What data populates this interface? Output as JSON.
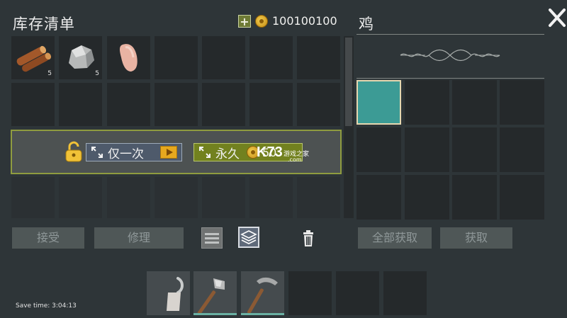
{
  "inventory": {
    "title": "库存清单",
    "coins": "100100100",
    "slots": [
      {
        "item": "wood-logs",
        "count": "5"
      },
      {
        "item": "stone",
        "count": "5"
      },
      {
        "item": "raw-chicken",
        "count": ""
      }
    ]
  },
  "unlock_panel": {
    "once_label": "仅一次",
    "permanent_label": "永久",
    "permanent_price": "50"
  },
  "watermark": {
    "logo": "K73",
    "site_name": "游戏之家",
    "domain": ".com"
  },
  "buttons": {
    "accept": "接受",
    "repair": "修理",
    "take_all": "全部获取",
    "take": "获取"
  },
  "loot": {
    "title": "鸡"
  },
  "hotbar": {
    "slots": [
      "hook",
      "stone-axe",
      "stone-pickaxe",
      "",
      "",
      ""
    ]
  },
  "status": {
    "save_time": "Save time: 3:04:13"
  },
  "colors": {
    "accent_green": "#8f9c3f",
    "selected_slot": "#3c9b95",
    "gold": "#e6a81e"
  }
}
